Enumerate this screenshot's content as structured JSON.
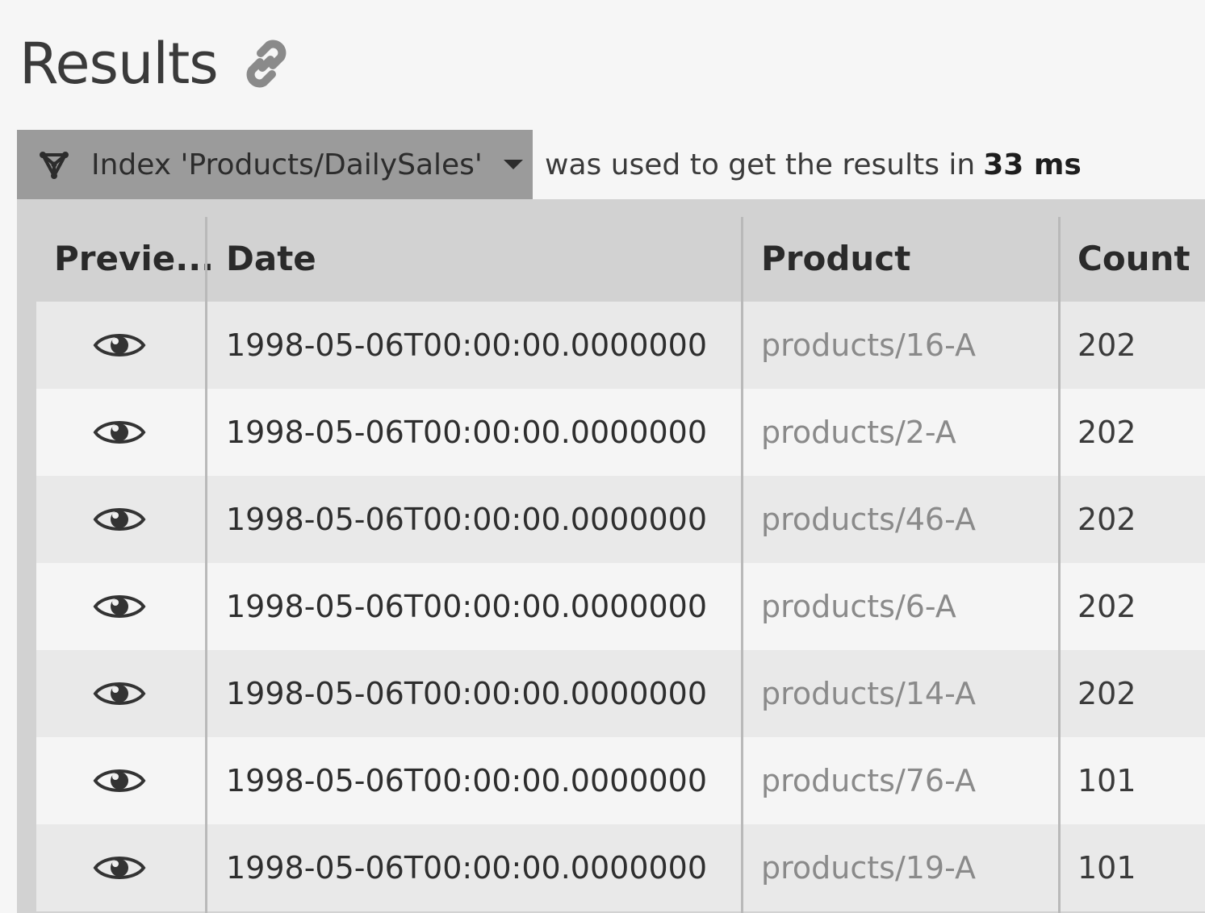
{
  "header": {
    "title": "Results"
  },
  "index_bar": {
    "index_label": "Index 'Products/DailySales'",
    "timing_prefix": "was used to get the results in",
    "timing_value": "33 ms"
  },
  "table": {
    "columns": [
      "Previe...",
      "Date",
      "Product",
      "Count"
    ],
    "rows": [
      {
        "date": "1998-05-06T00:00:00.0000000",
        "product": "products/16-A",
        "count": "202"
      },
      {
        "date": "1998-05-06T00:00:00.0000000",
        "product": "products/2-A",
        "count": "202"
      },
      {
        "date": "1998-05-06T00:00:00.0000000",
        "product": "products/46-A",
        "count": "202"
      },
      {
        "date": "1998-05-06T00:00:00.0000000",
        "product": "products/6-A",
        "count": "202"
      },
      {
        "date": "1998-05-06T00:00:00.0000000",
        "product": "products/14-A",
        "count": "202"
      },
      {
        "date": "1998-05-06T00:00:00.0000000",
        "product": "products/76-A",
        "count": "101"
      },
      {
        "date": "1998-05-06T00:00:00.0000000",
        "product": "products/19-A",
        "count": "101"
      }
    ]
  },
  "icons": {
    "title_link": "link-icon",
    "index": "index-icon",
    "dropdown": "chevron-down-icon",
    "row_preview": "eye-icon"
  }
}
